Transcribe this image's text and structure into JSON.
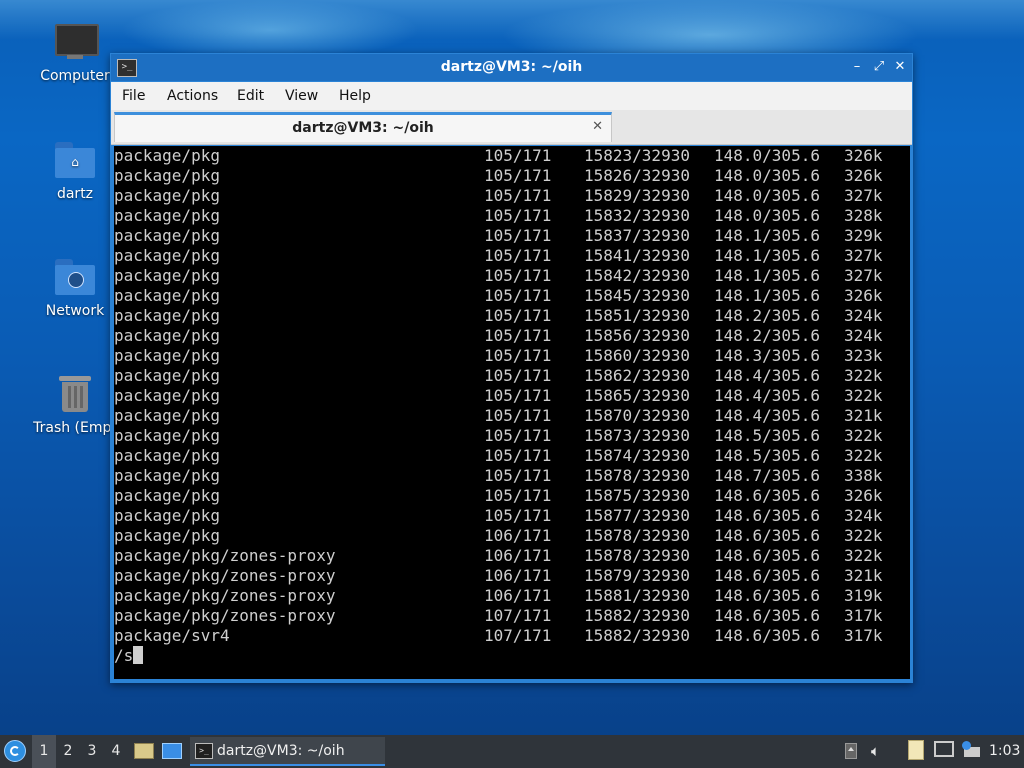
{
  "desktop": {
    "icons": [
      {
        "label": "Computer"
      },
      {
        "label": "dartz"
      },
      {
        "label": "Network"
      },
      {
        "label": "Trash (Empt"
      }
    ]
  },
  "window": {
    "title": "dartz@VM3: ~/oih",
    "app_icon": ">_",
    "controls": {
      "minimize": "–",
      "maximize": "⤢",
      "close": "✕"
    },
    "menu": [
      "File",
      "Actions",
      "Edit",
      "View",
      "Help"
    ],
    "tab": {
      "label": "dartz@VM3: ~/oih",
      "close": "✕"
    }
  },
  "terminal": {
    "rows": [
      [
        "package/pkg",
        "105/171",
        "15823/32930",
        "148.0/305.6",
        "326k"
      ],
      [
        "package/pkg",
        "105/171",
        "15826/32930",
        "148.0/305.6",
        "326k"
      ],
      [
        "package/pkg",
        "105/171",
        "15829/32930",
        "148.0/305.6",
        "327k"
      ],
      [
        "package/pkg",
        "105/171",
        "15832/32930",
        "148.0/305.6",
        "328k"
      ],
      [
        "package/pkg",
        "105/171",
        "15837/32930",
        "148.1/305.6",
        "329k"
      ],
      [
        "package/pkg",
        "105/171",
        "15841/32930",
        "148.1/305.6",
        "327k"
      ],
      [
        "package/pkg",
        "105/171",
        "15842/32930",
        "148.1/305.6",
        "327k"
      ],
      [
        "package/pkg",
        "105/171",
        "15845/32930",
        "148.1/305.6",
        "326k"
      ],
      [
        "package/pkg",
        "105/171",
        "15851/32930",
        "148.2/305.6",
        "324k"
      ],
      [
        "package/pkg",
        "105/171",
        "15856/32930",
        "148.2/305.6",
        "324k"
      ],
      [
        "package/pkg",
        "105/171",
        "15860/32930",
        "148.3/305.6",
        "323k"
      ],
      [
        "package/pkg",
        "105/171",
        "15862/32930",
        "148.4/305.6",
        "322k"
      ],
      [
        "package/pkg",
        "105/171",
        "15865/32930",
        "148.4/305.6",
        "322k"
      ],
      [
        "package/pkg",
        "105/171",
        "15870/32930",
        "148.4/305.6",
        "321k"
      ],
      [
        "package/pkg",
        "105/171",
        "15873/32930",
        "148.5/305.6",
        "322k"
      ],
      [
        "package/pkg",
        "105/171",
        "15874/32930",
        "148.5/305.6",
        "322k"
      ],
      [
        "package/pkg",
        "105/171",
        "15878/32930",
        "148.7/305.6",
        "338k"
      ],
      [
        "package/pkg",
        "105/171",
        "15875/32930",
        "148.6/305.6",
        "326k"
      ],
      [
        "package/pkg",
        "105/171",
        "15877/32930",
        "148.6/305.6",
        "324k"
      ],
      [
        "package/pkg",
        "106/171",
        "15878/32930",
        "148.6/305.6",
        "322k"
      ],
      [
        "package/pkg/zones-proxy",
        "106/171",
        "15878/32930",
        "148.6/305.6",
        "322k"
      ],
      [
        "package/pkg/zones-proxy",
        "106/171",
        "15879/32930",
        "148.6/305.6",
        "321k"
      ],
      [
        "package/pkg/zones-proxy",
        "106/171",
        "15881/32930",
        "148.6/305.6",
        "319k"
      ],
      [
        "package/pkg/zones-proxy",
        "107/171",
        "15882/32930",
        "148.6/305.6",
        "317k"
      ],
      [
        "package/svr4",
        "107/171",
        "15882/32930",
        "148.6/305.6",
        "317k"
      ]
    ],
    "prompt": "/s"
  },
  "taskbar": {
    "workspaces": [
      "1",
      "2",
      "3",
      "4"
    ],
    "active_workspace": "1",
    "task_label": "dartz@VM3: ~/oih",
    "clock": "1:03"
  },
  "colors": {
    "titlebar": "#1d6fc2",
    "window_border": "#2b83d6",
    "terminal_bg": "#000000",
    "terminal_fg": "#cfcfcf",
    "taskbar": "#2f343a"
  }
}
